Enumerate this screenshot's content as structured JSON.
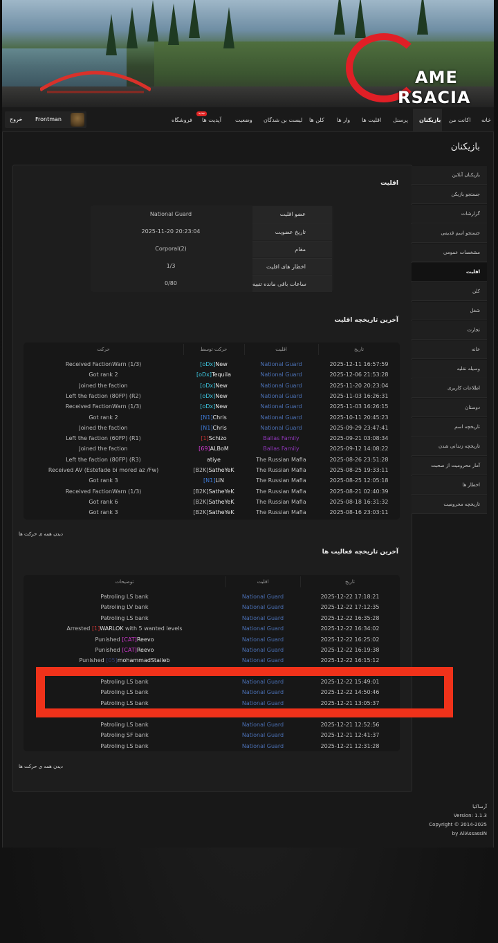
{
  "brand": {
    "logo_line1": "AME",
    "logo_line2": "RSACIA"
  },
  "nav": {
    "items": [
      {
        "label": "خانه"
      },
      {
        "label": "اکانت من"
      },
      {
        "label": "بازیکنان"
      },
      {
        "label": "پرسنل"
      },
      {
        "label": "اقلیت ها"
      },
      {
        "label": "وار ها"
      },
      {
        "label": "کلن ها"
      },
      {
        "label": "لیست بن شدگان"
      },
      {
        "label": "وضعیت"
      },
      {
        "label": "آپدیت ها"
      },
      {
        "label": "فروشگاه"
      }
    ],
    "badge": "جدید",
    "username": "Frontman",
    "logout": "خروج"
  },
  "page_title": "بازیکنان",
  "sidebar": {
    "items": [
      {
        "label": "بازیکنان آنلاین"
      },
      {
        "label": "جستجو بازیکن"
      },
      {
        "label": "گزارشات"
      },
      {
        "label": "جستجو اسم قدیمی"
      },
      {
        "label": "مشخصات عمومی"
      },
      {
        "label": "اقلیت"
      },
      {
        "label": "کلن"
      },
      {
        "label": "شغل"
      },
      {
        "label": "تجارت"
      },
      {
        "label": "خانه"
      },
      {
        "label": "وسیله نقلیه"
      },
      {
        "label": "اطلاعات کاربری"
      },
      {
        "label": "دوستان"
      },
      {
        "label": "تاریخچه اسم"
      },
      {
        "label": "تاریخچه زندانی شدن"
      },
      {
        "label": "آمار محرومیت از صحبت"
      },
      {
        "label": "اخطار ها"
      },
      {
        "label": "تاریخچه محرومیت"
      }
    ]
  },
  "faction": {
    "section_title": "اقلیت",
    "rows": [
      {
        "label": "عضو اقلیت",
        "value": "National Guard"
      },
      {
        "label": "تاریخ عضویت",
        "value": "2025-11-20 20:23:04"
      },
      {
        "label": "مقام",
        "value": "Corporal(2)"
      },
      {
        "label": "اخطار های اقلیت",
        "value": "1/3"
      },
      {
        "label": "ساعات باقی مانده تنبیه",
        "value": "0/80"
      }
    ]
  },
  "faction_history": {
    "section_title": "آخرین تاریخچه اقلیت",
    "headers": {
      "date": "تاریخ",
      "faction": "اقلیت",
      "by": "حرکت توسط",
      "action": "حرکت"
    },
    "rows": [
      {
        "date": "2025-12-11 16:57:59",
        "faction": "National Guard",
        "by_tag": "[oDx]",
        "by_name": "New",
        "action": "Received FactionWarn (1/3)"
      },
      {
        "date": "2025-12-06 21:53:28",
        "faction": "National Guard",
        "by_tag": "[oDx]",
        "by_name": "Tequila",
        "action": "Got rank 2"
      },
      {
        "date": "2025-11-20 20:23:04",
        "faction": "National Guard",
        "by_tag": "[oDx]",
        "by_name": "New",
        "action": "Joined the faction"
      },
      {
        "date": "2025-11-03 16:26:31",
        "faction": "National Guard",
        "by_tag": "[oDx]",
        "by_name": "New",
        "action": "Left the faction (80FP) (R2)"
      },
      {
        "date": "2025-11-03 16:26:15",
        "faction": "National Guard",
        "by_tag": "[oDx]",
        "by_name": "New",
        "action": "Received FactionWarn (1/3)"
      },
      {
        "date": "2025-10-11 20:45:23",
        "faction": "National Guard",
        "by_tag": "[N1]",
        "by_name": "Chris",
        "action": "Got rank 2"
      },
      {
        "date": "2025-09-29 23:47:41",
        "faction": "National Guard",
        "by_tag": "[N1]",
        "by_name": "Chris",
        "action": "Joined the faction"
      },
      {
        "date": "2025-09-21 03:08:34",
        "faction": "Ballas Family",
        "by_tag": "[1]",
        "by_name": "Schizo",
        "action": "Left the faction (60FP) (R1)"
      },
      {
        "date": "2025-09-12 14:08:22",
        "faction": "Ballas Family",
        "by_tag": "[69]",
        "by_name": "ALBoM",
        "action": "Joined the faction"
      },
      {
        "date": "2025-08-26 23:51:28",
        "faction": "The Russian Mafia",
        "by_tag": "",
        "by_name": "atiye",
        "action": "Left the faction (80FP) (R3)"
      },
      {
        "date": "2025-08-25 19:33:11",
        "faction": "The Russian Mafia",
        "by_tag": "[B2K]",
        "by_name": "SatheYeK",
        "action": "Received AV (Estefade bi mored az /Fw)"
      },
      {
        "date": "2025-08-25 12:05:18",
        "faction": "The Russian Mafia",
        "by_tag": "[N1]",
        "by_name": "LiN",
        "action": "Got rank 3"
      },
      {
        "date": "2025-08-21 02:40:39",
        "faction": "The Russian Mafia",
        "by_tag": "[B2K]",
        "by_name": "SatheYeK",
        "action": "Received FactionWarn (1/3)"
      },
      {
        "date": "2025-08-18 16:31:32",
        "faction": "The Russian Mafia",
        "by_tag": "[B2K]",
        "by_name": "SatheYeK",
        "action": "Got rank 6"
      },
      {
        "date": "2025-08-16 23:03:11",
        "faction": "The Russian Mafia",
        "by_tag": "[B2K]",
        "by_name": "SatheYeK",
        "action": "Got rank 3"
      }
    ],
    "view_all": "دیدن همه ی حرکت ها"
  },
  "activity_history": {
    "section_title": "آخرین تاریخچه فعالیت ها",
    "headers": {
      "date": "تاریخ",
      "faction": "اقلیت",
      "desc": "توضیحات"
    },
    "rows": [
      {
        "date": "2025-12-22 17:18:21",
        "faction": "National Guard",
        "pre": "Patroling LS bank",
        "tag": "",
        "name": "",
        "post": ""
      },
      {
        "date": "2025-12-22 17:12:35",
        "faction": "National Guard",
        "pre": "Patroling LV bank",
        "tag": "",
        "name": "",
        "post": ""
      },
      {
        "date": "2025-12-22 16:35:28",
        "faction": "National Guard",
        "pre": "Patroling LS bank",
        "tag": "",
        "name": "",
        "post": ""
      },
      {
        "date": "2025-12-22 16:34:02",
        "faction": "National Guard",
        "pre": "Arrested ",
        "tag": "[1]",
        "name": "WARLOK",
        "post": " with 5 wanted levels"
      },
      {
        "date": "2025-12-22 16:25:02",
        "faction": "National Guard",
        "pre": "Punished ",
        "tag": "[CAT]",
        "name": "Reevo",
        "post": ""
      },
      {
        "date": "2025-12-22 16:19:38",
        "faction": "National Guard",
        "pre": "Punished ",
        "tag": "[CAT]",
        "name": "Reevo",
        "post": ""
      },
      {
        "date": "2025-12-22 16:15:12",
        "faction": "National Guard",
        "pre": "Punished ",
        "tag": "[05]",
        "name": "mohammadStaiieb",
        "post": ""
      },
      {
        "date": "2025-12-22 15:49:01",
        "faction": "National Guard",
        "pre": "Patroling LS bank",
        "tag": "",
        "name": "",
        "post": ""
      },
      {
        "date": "2025-12-22 14:50:46",
        "faction": "National Guard",
        "pre": "Patroling LS bank",
        "tag": "",
        "name": "",
        "post": ""
      },
      {
        "date": "2025-12-21 13:05:37",
        "faction": "National Guard",
        "pre": "Patroling LS bank",
        "tag": "",
        "name": "",
        "post": ""
      },
      {
        "date": "2025-12-21 12:52:56",
        "faction": "National Guard",
        "pre": "Patroling LS bank",
        "tag": "",
        "name": "",
        "post": ""
      },
      {
        "date": "2025-12-21 12:41:37",
        "faction": "National Guard",
        "pre": "Patroling SF bank",
        "tag": "",
        "name": "",
        "post": ""
      },
      {
        "date": "2025-12-21 12:31:28",
        "faction": "National Guard",
        "pre": "Patroling LS bank",
        "tag": "",
        "name": "",
        "post": ""
      }
    ],
    "view_all": "دیدن همه ی حرکت ها"
  },
  "footer": {
    "site": "آرساکیا",
    "version": "Version: 1.1.3",
    "copyright": "Copyright © 2014-2025",
    "author": "by AliAssassiN"
  },
  "colors": {
    "accent_red": "#e01f26",
    "national_guard": "#4a6fb3",
    "ballas": "#8e36b8",
    "highlight": "#f0321a"
  }
}
